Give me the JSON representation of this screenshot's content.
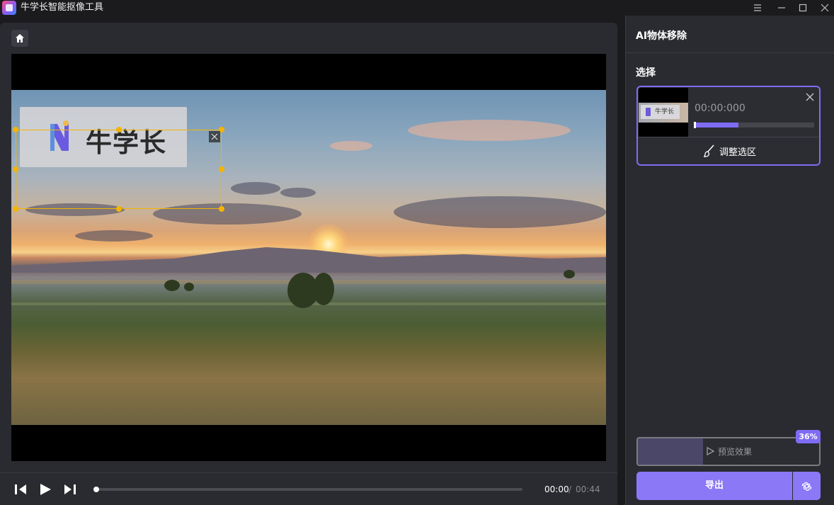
{
  "app": {
    "title": "牛学长智能抠像工具"
  },
  "video": {
    "overlay_logo_text": "牛学长",
    "current_time": "00:00",
    "separator": "/",
    "total_time": "00:44",
    "progress_fraction": 0.0
  },
  "side": {
    "title": "AI物体移除",
    "section_label": "选择",
    "selection_card": {
      "thumb_text": "牛学长",
      "time": "00:00:000",
      "range_fraction": 0.37,
      "adjust_label": "调整选区"
    },
    "preview": {
      "label": "预览效果",
      "percent_text": "36%",
      "progress_fraction": 0.36
    },
    "export_label": "导出"
  },
  "colors": {
    "accent": "#8b78f7",
    "selection_border": "#f5b400",
    "panel_bg": "#2a2b30"
  },
  "icons": [
    "app-logo-icon",
    "menu-icon",
    "minimize-icon",
    "maximize-icon",
    "close-icon",
    "home-icon",
    "close-selection-icon",
    "step-back-icon",
    "play-icon",
    "step-forward-icon",
    "brush-icon",
    "play-outline-icon",
    "settings-gear-icon"
  ]
}
